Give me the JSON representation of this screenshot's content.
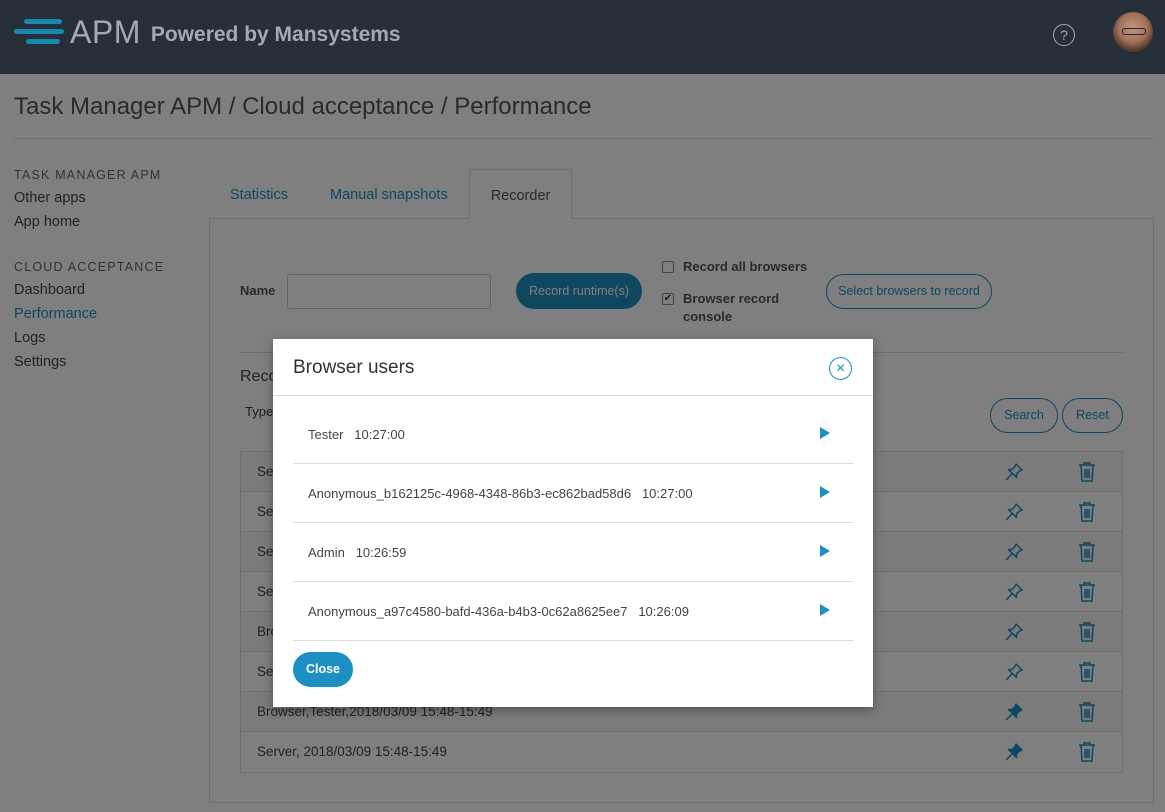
{
  "header": {
    "brand": "APM",
    "powered_by": "Powered by Mansystems",
    "help_icon": "question-icon",
    "avatar": "user-avatar"
  },
  "page": {
    "breadcrumb": "Task Manager APM / Cloud acceptance / Performance"
  },
  "sidebar": {
    "section1_heading": "TASK MANAGER APM",
    "section1_items": [
      "Other apps",
      "App home"
    ],
    "section2_heading": "CLOUD ACCEPTANCE",
    "section2_items": [
      "Dashboard",
      "Performance",
      "Logs",
      "Settings"
    ],
    "active_item": "Performance"
  },
  "tabs": [
    "Statistics",
    "Manual snapshots",
    "Recorder"
  ],
  "active_tab": "Recorder",
  "recorder": {
    "name_label": "Name",
    "name_value": "",
    "record_button": "Record runtime(s)",
    "record_all_browsers_label": "Record all browsers",
    "record_all_browsers_checked": false,
    "browser_console_label_line1": "Browser record",
    "browser_console_label_line2": "console",
    "browser_console_checked": true,
    "select_browsers_button": "Select browsers to record",
    "recordings_heading": "Reco",
    "type_label": "Type",
    "search_button": "Search",
    "reset_button": "Reset",
    "rows": [
      {
        "text": "Se",
        "pinned": false
      },
      {
        "text": "Se",
        "pinned": false
      },
      {
        "text": "Se",
        "pinned": false
      },
      {
        "text": "Se",
        "pinned": false
      },
      {
        "text": "Bro",
        "pinned": false
      },
      {
        "text": "Se",
        "pinned": false
      },
      {
        "text": "Browser,Tester,2018/03/09 15:48-15:49",
        "pinned": true
      },
      {
        "text": "Server, 2018/03/09 15:48-15:49",
        "pinned": true
      }
    ]
  },
  "modal": {
    "title": "Browser users",
    "close_button": "Close",
    "users": [
      {
        "name": "Tester",
        "time": "10:27:00"
      },
      {
        "name": "Anonymous_b162125c-4968-4348-86b3-ec862bad58d6",
        "time": "10:27:00"
      },
      {
        "name": "Admin",
        "time": "10:26:59"
      },
      {
        "name": "Anonymous_a97c4580-bafd-436a-b4b3-0c62a8625ee7",
        "time": "10:26:09"
      }
    ]
  },
  "colors": {
    "accent": "#1e8fc2",
    "topbar": "#2f3a46"
  }
}
